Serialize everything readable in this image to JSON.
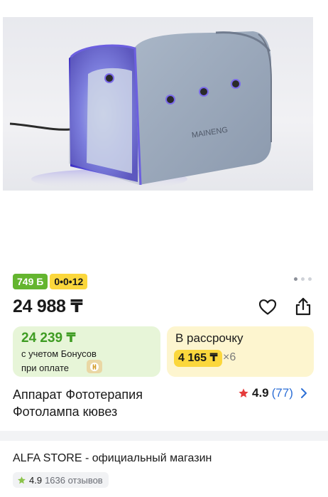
{
  "product": {
    "image_alt": "",
    "brand_on_image": "MAINENG",
    "gallery_dots": 3,
    "gallery_active": 0,
    "title": "Аппарат Фототерапия Фотолампа кювез"
  },
  "badges": {
    "bonus_badge": "749 Б",
    "installment_badge": "0•0•12"
  },
  "price": {
    "main": "24 988 ₸",
    "bonus_price": "24 239 ₸",
    "bonus_line1": "с учетом Бонусов",
    "bonus_line2": "при оплате",
    "installment_label": "В рассрочку",
    "installment_amount": "4 165 ₸",
    "installment_times": "×6"
  },
  "rating": {
    "value": "4.9",
    "count": "(77)"
  },
  "store": {
    "name": "ALFA STORE - официальный магазин",
    "rating": "4.9",
    "reviews": "1636 отзывов"
  },
  "colors": {
    "green": "#64b52f",
    "yellow": "#fbd73c",
    "link": "#2d6fd6",
    "star": "#e53b3b"
  },
  "icons": [
    "heart-icon",
    "share-icon",
    "star-icon",
    "chevron-right-icon",
    "bonus-pay-icon"
  ]
}
